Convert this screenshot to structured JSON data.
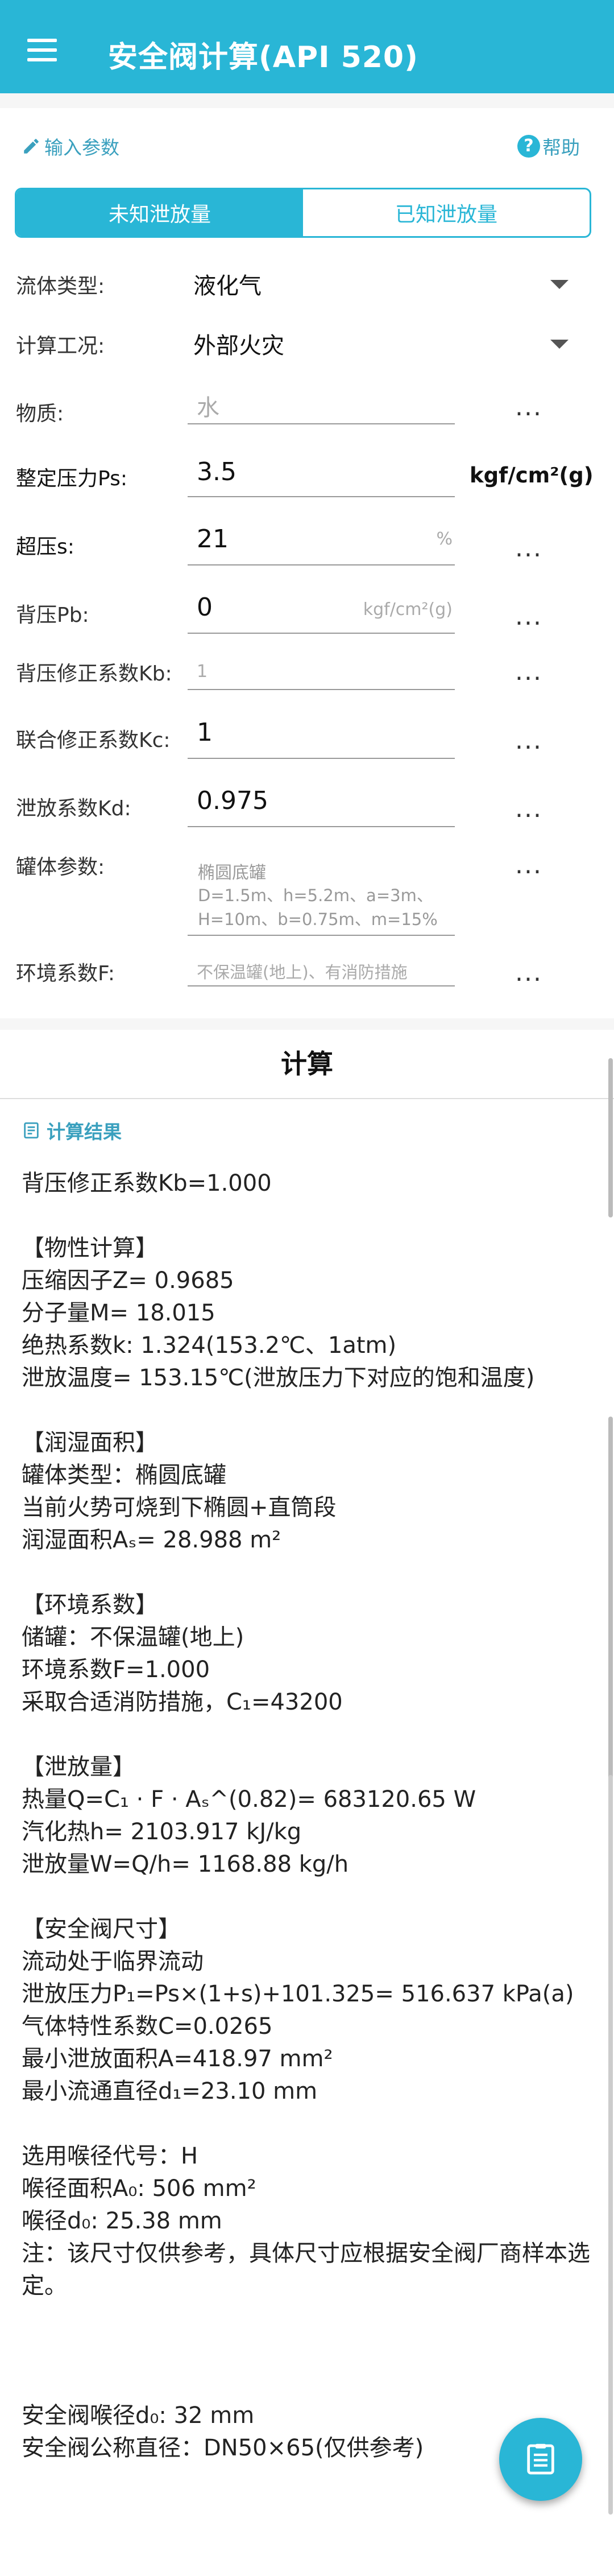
{
  "appbar": {
    "title": "安全阀计算(API 520)"
  },
  "params": {
    "header": "输入参数",
    "help": "帮助",
    "tabs": [
      "未知泄放量",
      "已知泄放量"
    ],
    "fluid_type": {
      "label": "流体类型:",
      "value": "液化气"
    },
    "condition": {
      "label": "计算工况:",
      "value": "外部火灾"
    },
    "substance": {
      "label": "物质:",
      "value": "水"
    },
    "set_pressure": {
      "label": "整定压力Ps:",
      "value": "3.5",
      "unit": "kgf/cm²(g)"
    },
    "overpressure": {
      "label": "超压s:",
      "value": "21",
      "unit": "%"
    },
    "back_pressure": {
      "label": "背压Pb:",
      "value": "0",
      "unit": "kgf/cm²(g)"
    },
    "kb": {
      "label": "背压修正系数Kb:",
      "value": "1"
    },
    "kc": {
      "label": "联合修正系数Kc:",
      "value": "1"
    },
    "kd": {
      "label": "泄放系数Kd:",
      "value": "0.975"
    },
    "tank": {
      "label": "罐体参数:",
      "line1": "椭圆底罐",
      "line2": "D=1.5m、h=5.2m、a=3m、H=10m、b=0.75m、m=15%"
    },
    "env": {
      "label": "环境系数F:",
      "value": "不保温罐(地上)、有消防措施"
    },
    "dots": "..."
  },
  "calc_button": "计算",
  "results": {
    "header": "计算结果",
    "text": "背压修正系数Kb=1.000\n\n【物性计算】\n压缩因子Z= 0.9685\n分子量M= 18.015\n绝热系数k: 1.324(153.2℃、1atm)\n泄放温度= 153.15℃(泄放压力下对应的饱和温度)\n\n【润湿面积】\n罐体类型：椭圆底罐\n当前火势可烧到下椭圆+直筒段\n润湿面积Aₛ= 28.988 m²\n\n【环境系数】\n储罐：不保温罐(地上)\n环境系数F=1.000\n采取合适消防措施，C₁=43200\n\n【泄放量】\n热量Q=C₁ · F · Aₛ^(0.82)= 683120.65 W\n汽化热h= 2103.917 kJ/kg\n泄放量W=Q/h= 1168.88 kg/h\n\n【安全阀尺寸】\n流动处于临界流动\n泄放压力P₁=Ps×(1+s)+101.325= 516.637 kPa(a)\n气体特性系数C=0.0265\n最小泄放面积A=418.97 mm²\n最小流通直径d₁=23.10 mm\n\n选用喉径代号：H\n喉径面积A₀: 506 mm²\n喉径d₀: 25.38 mm\n注：该尺寸仅供参考，具体尺寸应根据安全阀厂商样本选定。\n\n\n\n安全阀喉径d₀: 32 mm\n安全阀公称直径：DN50×65(仅供参考)"
  },
  "colors": {
    "accent": "#29b6d6"
  }
}
